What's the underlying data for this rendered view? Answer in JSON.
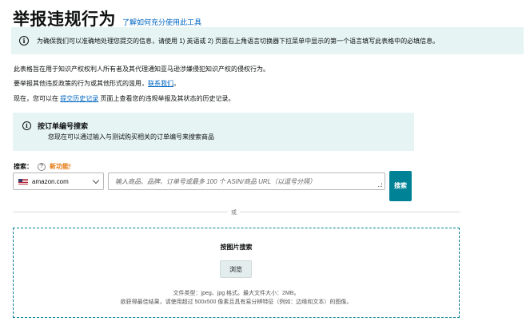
{
  "header": {
    "title": "举报违规行为",
    "help_link": "了解如何充分使用此工具"
  },
  "banner": {
    "icon": "info-icon",
    "text": "为确保我们可以准确地处理您提交的信息，请使用 1) 英语或 2) 页面右上角语言切换器下拉菜单中显示的第一个语言填写此表格中的必填信息。"
  },
  "intro": {
    "line1": "此表格旨在用于知识产权权利人所有者及其代理通知亚马逊涉嫌侵犯知识产权的侵权行为。",
    "line2_prefix": "要举报其他违反政策的行为或其他形式的滥用，",
    "line2_link": "联系我们",
    "line2_suffix": "。",
    "line3_prefix": "现在，您可以在 ",
    "line3_link": "提交历史记录",
    "line3_suffix": " 页面上查看您的违规举报及其状态的历史记录。"
  },
  "order_search": {
    "icon": "info-icon",
    "title": "按订单编号搜索",
    "subtitle": "您现在可以通过输入与测试购买相关的订单编号来搜索商品"
  },
  "search": {
    "label": "搜索：",
    "help": "?",
    "new_feature": "新功能!",
    "store": "amazon.com",
    "placeholder": "输入商品、品牌、订单号或最多 100 个 ASIN/商品 URL（以逗号分隔）",
    "button": "搜索"
  },
  "divider": {
    "label": "或"
  },
  "image_search": {
    "title": "按图片搜索",
    "browse": "浏览",
    "note1": "文件类型：jpeg、jpg 格式。最大文件大小：2MB。",
    "note2": "欲获得最佳结果，请使用超过 500x500 像素且具有易分辨特征（例如：边缘和文本）的图像。"
  },
  "colors": {
    "accent": "#008296",
    "banner_bg": "#e6f4f4",
    "link": "#0066c0",
    "new_feature": "#e47911"
  }
}
